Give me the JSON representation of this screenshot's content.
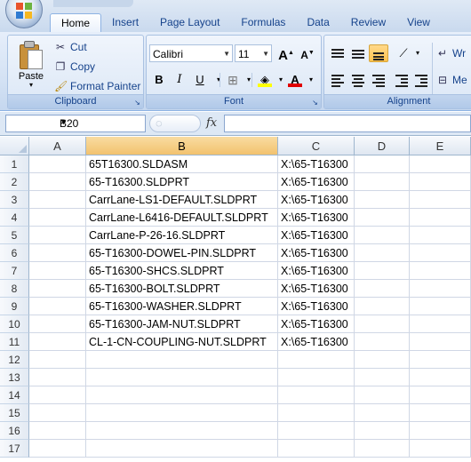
{
  "ribbon": {
    "tabs": [
      "Home",
      "Insert",
      "Page Layout",
      "Formulas",
      "Data",
      "Review",
      "View"
    ],
    "active_tab": "Home",
    "clipboard": {
      "paste": "Paste",
      "cut": "Cut",
      "copy": "Copy",
      "format_painter": "Format Painter",
      "label": "Clipboard"
    },
    "font": {
      "name": "Calibri",
      "size": "11",
      "label": "Font",
      "grow": "A",
      "shrink": "A",
      "bold": "B",
      "italic": "I",
      "underline": "U",
      "font_color": "A"
    },
    "alignment": {
      "label": "Alignment",
      "wrap": "Wr",
      "merge": "Me"
    }
  },
  "formula_bar": {
    "name_box": "B20",
    "fx": "fx",
    "formula": ""
  },
  "sheet": {
    "columns": [
      "A",
      "B",
      "C",
      "D",
      "E"
    ],
    "selected_column": "B",
    "rows": [
      "1",
      "2",
      "3",
      "4",
      "5",
      "6",
      "7",
      "8",
      "9",
      "10",
      "11",
      "12",
      "13",
      "14",
      "15",
      "16",
      "17"
    ],
    "data": [
      {
        "b": "65T16300.SLDASM",
        "c": "X:\\65-T16300"
      },
      {
        "b": "65-T16300.SLDPRT",
        "c": "X:\\65-T16300"
      },
      {
        "b": "CarrLane-LS1-DEFAULT.SLDPRT",
        "c": "X:\\65-T16300"
      },
      {
        "b": "CarrLane-L6416-DEFAULT.SLDPRT",
        "c": "X:\\65-T16300"
      },
      {
        "b": "CarrLane-P-26-16.SLDPRT",
        "c": "X:\\65-T16300"
      },
      {
        "b": "65-T16300-DOWEL-PIN.SLDPRT",
        "c": "X:\\65-T16300"
      },
      {
        "b": "65-T16300-SHCS.SLDPRT",
        "c": "X:\\65-T16300"
      },
      {
        "b": "65-T16300-BOLT.SLDPRT",
        "c": "X:\\65-T16300"
      },
      {
        "b": "65-T16300-WASHER.SLDPRT",
        "c": "X:\\65-T16300"
      },
      {
        "b": "65-T16300-JAM-NUT.SLDPRT",
        "c": "X:\\65-T16300"
      },
      {
        "b": "CL-1-CN-COUPLING-NUT.SLDPRT",
        "c": "X:\\65-T16300"
      }
    ]
  }
}
